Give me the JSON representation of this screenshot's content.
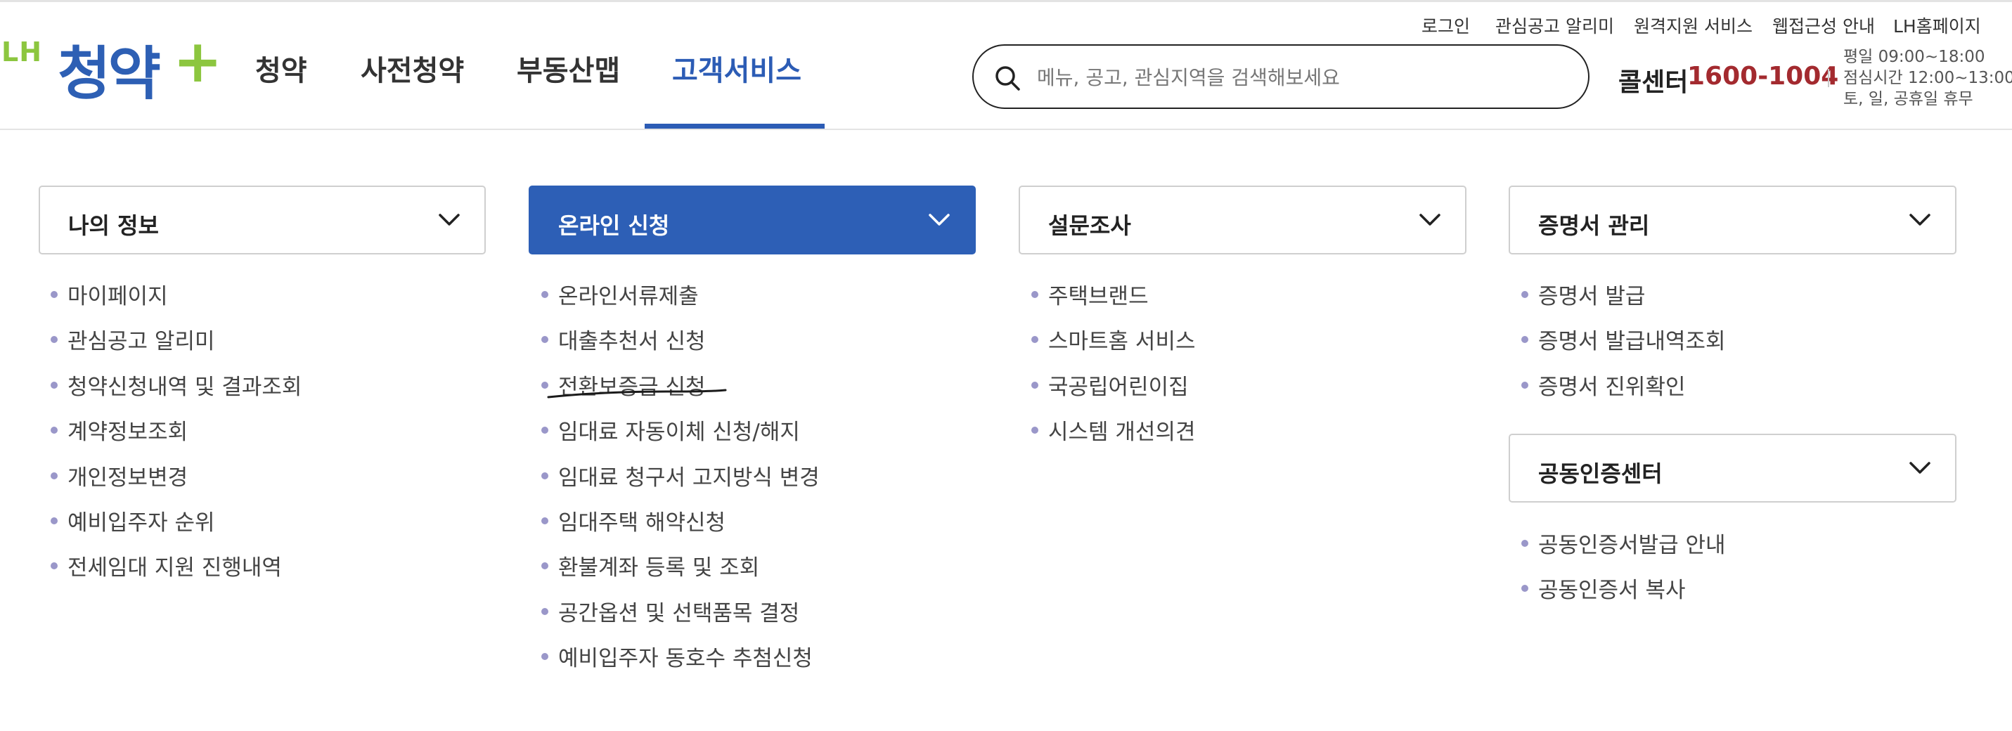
{
  "brand": {
    "lh": "LH",
    "name": "청약",
    "plus": "+"
  },
  "gnb": [
    {
      "label": "청약"
    },
    {
      "label": "사전청약"
    },
    {
      "label": "부동산맵"
    },
    {
      "label": "고객서비스",
      "active": true
    }
  ],
  "util_links": [
    "로그인",
    "관심공고 알리미",
    "원격지원 서비스",
    "웹접근성 안내",
    "LH홈페이지"
  ],
  "search": {
    "placeholder": "메뉴, 공고, 관심지역을 검색해보세요",
    "value": ""
  },
  "call_center": {
    "label": "콜센터",
    "number": "1600-1004",
    "hours": [
      "평일 09:00~18:00",
      "점심시간 12:00~13:00",
      "토, 일, 공휴일 휴무"
    ]
  },
  "panels": [
    {
      "title": "나의 정보",
      "active": false,
      "items": [
        "마이페이지",
        "관심공고 알리미",
        "청약신청내역 및 결과조회",
        "계약정보조회",
        "개인정보변경",
        "예비입주자 순위",
        "전세임대 지원 진행내역"
      ]
    },
    {
      "title": "온라인 신청",
      "active": true,
      "items": [
        "온라인서류제출",
        "대출추천서 신청",
        "전환보증금 신청",
        "임대료 자동이체 신청/해지",
        "임대료 청구서 고지방식 변경",
        "임대주택 해약신청",
        "환불계좌 등록 및 조회",
        "공간옵션 및 선택품목 결정",
        "예비입주자 동호수 추첨신청"
      ]
    },
    {
      "title": "설문조사",
      "active": false,
      "items": [
        "주택브랜드",
        "스마트홈 서비스",
        "국공립어린이집",
        "시스템 개선의견"
      ]
    },
    {
      "title": "증명서 관리",
      "active": false,
      "items": [
        "증명서 발급",
        "증명서 발급내역조회",
        "증명서 진위확인"
      ]
    },
    {
      "title": "공동인증센터",
      "active": false,
      "items": [
        "공동인증서발급 안내",
        "공동인증서 복사"
      ]
    }
  ],
  "colors": {
    "accent": "#2c5cb5",
    "brand_green": "#8cc63f",
    "call_number": "#a32a2f",
    "bullet": "#9a97c9"
  }
}
